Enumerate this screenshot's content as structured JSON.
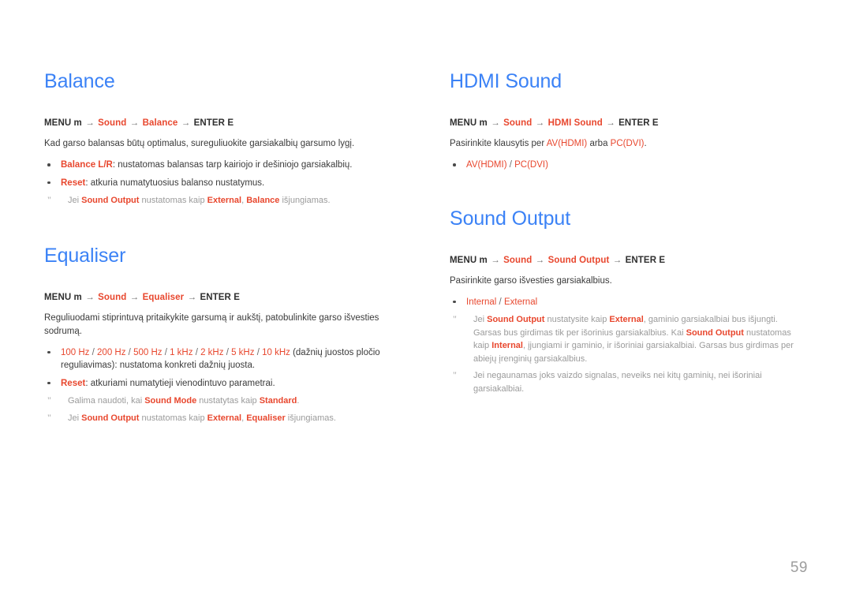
{
  "page": {
    "number": "59",
    "accent_color": "#e8472e",
    "heading_color": "#3b82f6",
    "note_color": "#9b9b9b",
    "arrow_glyph": "→",
    "note_marker": "\"",
    "bullet_glyph": "•"
  },
  "left_column": {
    "balance": {
      "title": "Balance",
      "menu_path": {
        "prefix": "MENU m",
        "arrow1": "→",
        "item1": "Sound",
        "arrow2": "→",
        "item2": "Balance",
        "arrow3": "→",
        "suffix": "ENTER E"
      },
      "intro": "Kad garso balansas būtų optimalus, sureguliuokite garsiakalbių garsumo lygį.",
      "bullets": [
        {
          "accent": "Balance L/R",
          "rest": ": nustatomas balansas tarp kairiojo ir dešiniojo garsiakalbių."
        },
        {
          "accent": "Reset",
          "rest": ": atkuria numatytuosius balanso nustatymus."
        }
      ],
      "notes": [
        {
          "marker": "\"",
          "parts": [
            {
              "t": "Jei ",
              "k": "plain"
            },
            {
              "t": "Sound Output",
              "k": "accent"
            },
            {
              "t": " nustatomas kaip ",
              "k": "plain"
            },
            {
              "t": "External",
              "k": "accent"
            },
            {
              "t": ", ",
              "k": "plain"
            },
            {
              "t": "Balance",
              "k": "accent"
            },
            {
              "t": " išjungiamas.",
              "k": "plain"
            }
          ]
        }
      ]
    },
    "equaliser": {
      "title": "Equaliser",
      "menu_path": {
        "prefix": "MENU m",
        "arrow1": "→",
        "item1": "Sound",
        "arrow2": "→",
        "item2": "Equaliser",
        "arrow3": "→",
        "suffix": "ENTER E"
      },
      "intro": "Reguliuodami stiprintuvą pritaikykite garsumą ir aukštį, patobulinkite garso išvesties sodrumą.",
      "frequency_bullet": {
        "frequencies": [
          "100 Hz",
          "200 Hz",
          "500 Hz",
          "1 kHz",
          "2 kHz",
          "5 kHz",
          "10 kHz"
        ],
        "separator": " / ",
        "rest": " (dažnių juostos pločio reguliavimas): nustatoma konkreti dažnių juosta."
      },
      "bullets": [
        {
          "accent": "Reset",
          "rest": ": atkuriami numatytieji vienodintuvo parametrai."
        }
      ],
      "notes": [
        {
          "marker": "\"",
          "parts": [
            {
              "t": "Galima naudoti, kai ",
              "k": "plain"
            },
            {
              "t": "Sound Mode",
              "k": "accent"
            },
            {
              "t": " nustatytas kaip ",
              "k": "plain"
            },
            {
              "t": "Standard",
              "k": "accent"
            },
            {
              "t": ".",
              "k": "plain"
            }
          ]
        },
        {
          "marker": "\"",
          "parts": [
            {
              "t": "Jei ",
              "k": "plain"
            },
            {
              "t": "Sound Output",
              "k": "accent"
            },
            {
              "t": " nustatomas kaip ",
              "k": "plain"
            },
            {
              "t": "External",
              "k": "accent"
            },
            {
              "t": ", ",
              "k": "plain"
            },
            {
              "t": "Equaliser",
              "k": "accent"
            },
            {
              "t": " išjungiamas.",
              "k": "plain"
            }
          ]
        }
      ]
    }
  },
  "right_column": {
    "hdmi_sound": {
      "title": "HDMI Sound",
      "menu_path": {
        "prefix": "MENU m",
        "arrow1": "→",
        "item1": "Sound",
        "arrow2": "→",
        "item2": "HDMI Sound",
        "arrow3": "→",
        "suffix": "ENTER E"
      },
      "intro_parts": [
        {
          "t": "Pasirinkite klausytis per ",
          "k": "plain"
        },
        {
          "t": "AV(HDMI)",
          "k": "accent"
        },
        {
          "t": " arba ",
          "k": "plain"
        },
        {
          "t": "PC(DVI)",
          "k": "accent"
        },
        {
          "t": ".",
          "k": "plain"
        }
      ],
      "option_bullet": {
        "option1": "AV(HDMI)",
        "separator": " / ",
        "option2": "PC(DVI)"
      }
    },
    "sound_output": {
      "title": "Sound Output",
      "menu_path": {
        "prefix": "MENU m",
        "arrow1": "→",
        "item1": "Sound",
        "arrow2": "→",
        "item2": "Sound Output",
        "arrow3": "→",
        "suffix": "ENTER E"
      },
      "intro": "Pasirinkite garso išvesties garsiakalbius.",
      "option_bullet": {
        "option1": "Internal",
        "separator": " / ",
        "option2": "External"
      },
      "notes": [
        {
          "marker": "\"",
          "parts": [
            {
              "t": "Jei ",
              "k": "plain"
            },
            {
              "t": "Sound Output",
              "k": "accent"
            },
            {
              "t": " nustatysite kaip ",
              "k": "plain"
            },
            {
              "t": "External",
              "k": "accent"
            },
            {
              "t": ", gaminio garsiakalbiai bus išjungti. Garsas bus girdimas tik per išorinius garsiakalbius. Kai ",
              "k": "plain"
            },
            {
              "t": "Sound Output",
              "k": "accent"
            },
            {
              "t": " nustatomas kaip ",
              "k": "plain"
            },
            {
              "t": "Internal",
              "k": "accent"
            },
            {
              "t": ", įjungiami ir gaminio, ir išoriniai garsiakalbiai. Garsas bus girdimas per abiejų įrenginių garsiakalbius.",
              "k": "plain"
            }
          ]
        },
        {
          "marker": "\"",
          "parts": [
            {
              "t": "Jei negaunamas joks vaizdo signalas, neveiks nei kitų gaminių, nei išoriniai garsiakalbiai.",
              "k": "plain"
            }
          ]
        }
      ]
    }
  }
}
